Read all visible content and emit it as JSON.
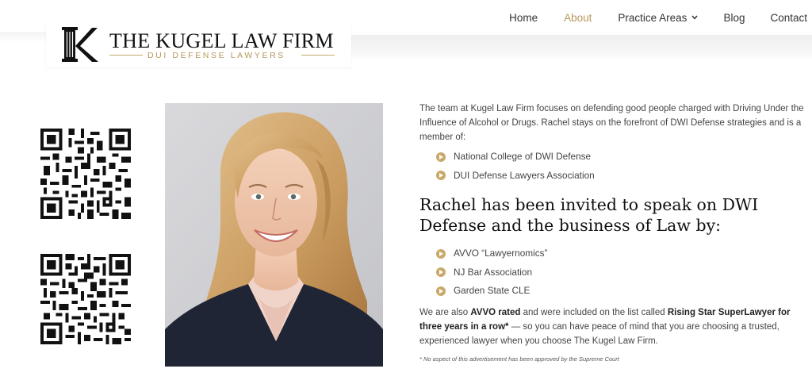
{
  "nav": {
    "items": [
      {
        "label": "Home"
      },
      {
        "label": "About",
        "active": true
      },
      {
        "label": "Practice Areas",
        "has_dropdown": true
      },
      {
        "label": "Blog"
      },
      {
        "label": "Contact"
      }
    ]
  },
  "logo": {
    "title": "THE KUGEL LAW FIRM",
    "subtitle": "DUI DEFENSE LAWYERS",
    "mark_letter": "K"
  },
  "colors": {
    "accent": "#b8975a",
    "text": "#444444",
    "heading": "#111111"
  },
  "main": {
    "intro": "The team at Kugel Law Firm focuses on defending good people charged with Driving Under the Influence of Alcohol or Drugs. Rachel stays on the forefront of DWI Defense strategies and is a member of:",
    "memberships": [
      "National College of DWI Defense",
      "DUI Defense Lawyers Association"
    ],
    "speaking_heading": "Rachel has been invited to speak on DWI Defense and the business of Law by:",
    "speaking_list": [
      "AVVO “Lawyernomics”",
      "NJ Bar Association",
      "Garden State CLE"
    ],
    "closing_1": "We are also ",
    "closing_bold_1": "AVVO rated",
    "closing_2": " and were included on the list called ",
    "closing_bold_2": "Rising Star SuperLawyer for three years in a row*",
    "closing_3": " — so you can have peace of mind that you are choosing a trusted, experienced lawyer when you choose The Kugel Law Firm.",
    "disclaimer": "* No aspect of this advertisement has been approved by the Supreme Court"
  },
  "icons": {
    "dropdown": "chevron-down-icon",
    "bullet": "circle-arrow-icon"
  }
}
